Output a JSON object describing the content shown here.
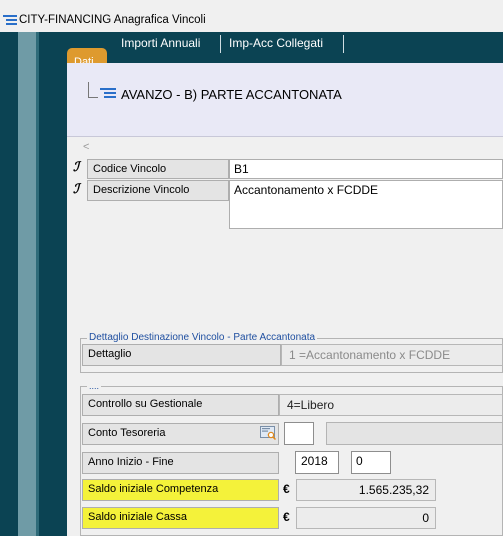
{
  "window": {
    "app_name": "CITY-FINANCING",
    "title": "Anagrafica Vincoli"
  },
  "tabs": {
    "active": "Dati",
    "items": [
      "Importi Annuali",
      "Imp-Acc Collegati"
    ]
  },
  "tree": {
    "node_label": "AVANZO - B) PARTE ACCANTONATA"
  },
  "collapse_glyph": "<",
  "fields": {
    "codice": {
      "label": "Codice Vincolo",
      "value": "B1"
    },
    "descrizione": {
      "label": "Descrizione Vincolo",
      "value": "Accantonamento x FCDDE"
    }
  },
  "destinazione": {
    "group_title": "Dettaglio Destinazione Vincolo - Parte Accantonata",
    "label": "Dettaglio",
    "value": "1 =Accantonamento x FCDDE"
  },
  "details": {
    "group_title": "....",
    "controllo": {
      "label": "Controllo su Gestionale",
      "value": "4=Libero"
    },
    "conto": {
      "label": "Conto Tesoreria",
      "value": ""
    },
    "anno": {
      "label": "Anno Inizio - Fine",
      "start": "2018",
      "end": "0"
    },
    "saldo_competenza": {
      "label": "Saldo iniziale Competenza",
      "currency": "€",
      "value": "1.565.235,32"
    },
    "saldo_cassa": {
      "label": "Saldo iniziale Cassa",
      "currency": "€",
      "value": "0"
    }
  },
  "colors": {
    "sidebar": "#0b4353",
    "active_tab": "#de9a2e",
    "highlight": "#f4f23a",
    "group_title": "#1f4fa0"
  }
}
